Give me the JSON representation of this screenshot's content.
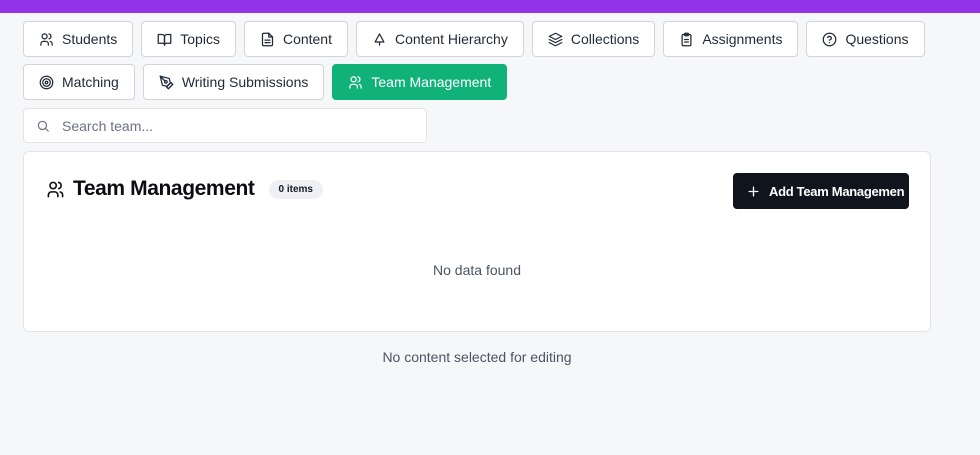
{
  "tabs": {
    "students": "Students",
    "topics": "Topics",
    "content": "Content",
    "content_hierarchy": "Content Hierarchy",
    "collections": "Collections",
    "assignments": "Assignments",
    "questions": "Questions",
    "matching": "Matching",
    "writing_submissions": "Writing Submissions",
    "team_management": "Team Management",
    "active": "team_management"
  },
  "search": {
    "placeholder": "Search team..."
  },
  "card": {
    "title": "Team Management",
    "count_badge": "0 items",
    "add_button_label": "Add Team Managemen",
    "empty_message": "No data found"
  },
  "footer_note": "No content selected for editing",
  "colors": {
    "accent_bar": "#9333ea",
    "active_tab": "#10b27a",
    "primary_button": "#0f141d"
  }
}
